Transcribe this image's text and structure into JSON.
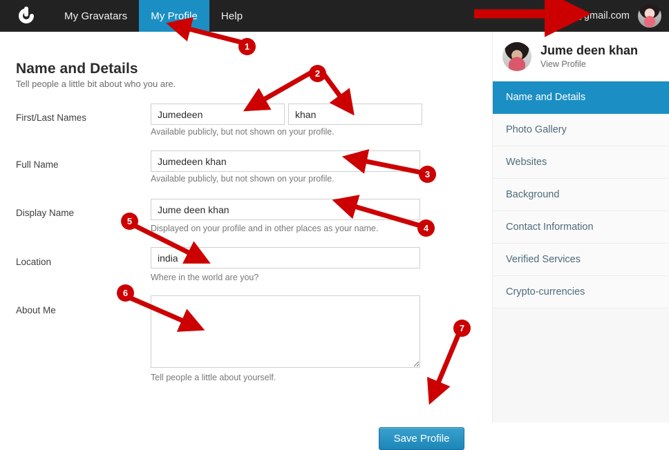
{
  "topnav": {
    "brand_icon": "gravatar-logo-icon",
    "items": [
      {
        "label": "My Gravatars",
        "active": false
      },
      {
        "label": "My Profile",
        "active": true
      },
      {
        "label": "Help",
        "active": false
      }
    ],
    "account_email": "@gmail.com",
    "avatar_icon": "user-avatar"
  },
  "main": {
    "title": "Name and Details",
    "subtitle": "Tell people a little bit about who you are.",
    "fields": {
      "names_label": "First/Last Names",
      "first_name_value": "Jumedeen",
      "last_name_value": "khan",
      "names_hint": "Available publicly, but not shown on your profile.",
      "full_name_label": "Full Name",
      "full_name_value": "Jumedeen khan",
      "full_name_hint": "Available publicly, but not shown on your profile.",
      "display_name_label": "Display Name",
      "display_name_value": "Jume deen khan",
      "display_name_hint": "Displayed on your profile and in other places as your name.",
      "location_label": "Location",
      "location_value": "india",
      "location_hint": "Where in the world are you?",
      "about_me_label": "About Me",
      "about_me_value": "",
      "about_me_hint": "Tell people a little about yourself."
    },
    "save_label": "Save Profile"
  },
  "sidebar": {
    "profile_name": "Jume deen khan",
    "view_profile_label": "View Profile",
    "items": [
      {
        "label": "Name and Details",
        "active": true
      },
      {
        "label": "Photo Gallery",
        "active": false
      },
      {
        "label": "Websites",
        "active": false
      },
      {
        "label": "Background",
        "active": false
      },
      {
        "label": "Contact Information",
        "active": false
      },
      {
        "label": "Verified Services",
        "active": false
      },
      {
        "label": "Crypto-currencies",
        "active": false
      }
    ]
  },
  "annotations": {
    "color": "#cc0000",
    "badges": [
      "1",
      "2",
      "3",
      "4",
      "5",
      "6",
      "7"
    ]
  },
  "colors": {
    "accent_blue": "#1b8fc4",
    "nav_dark": "#222222",
    "annotation_red": "#cc0000"
  }
}
